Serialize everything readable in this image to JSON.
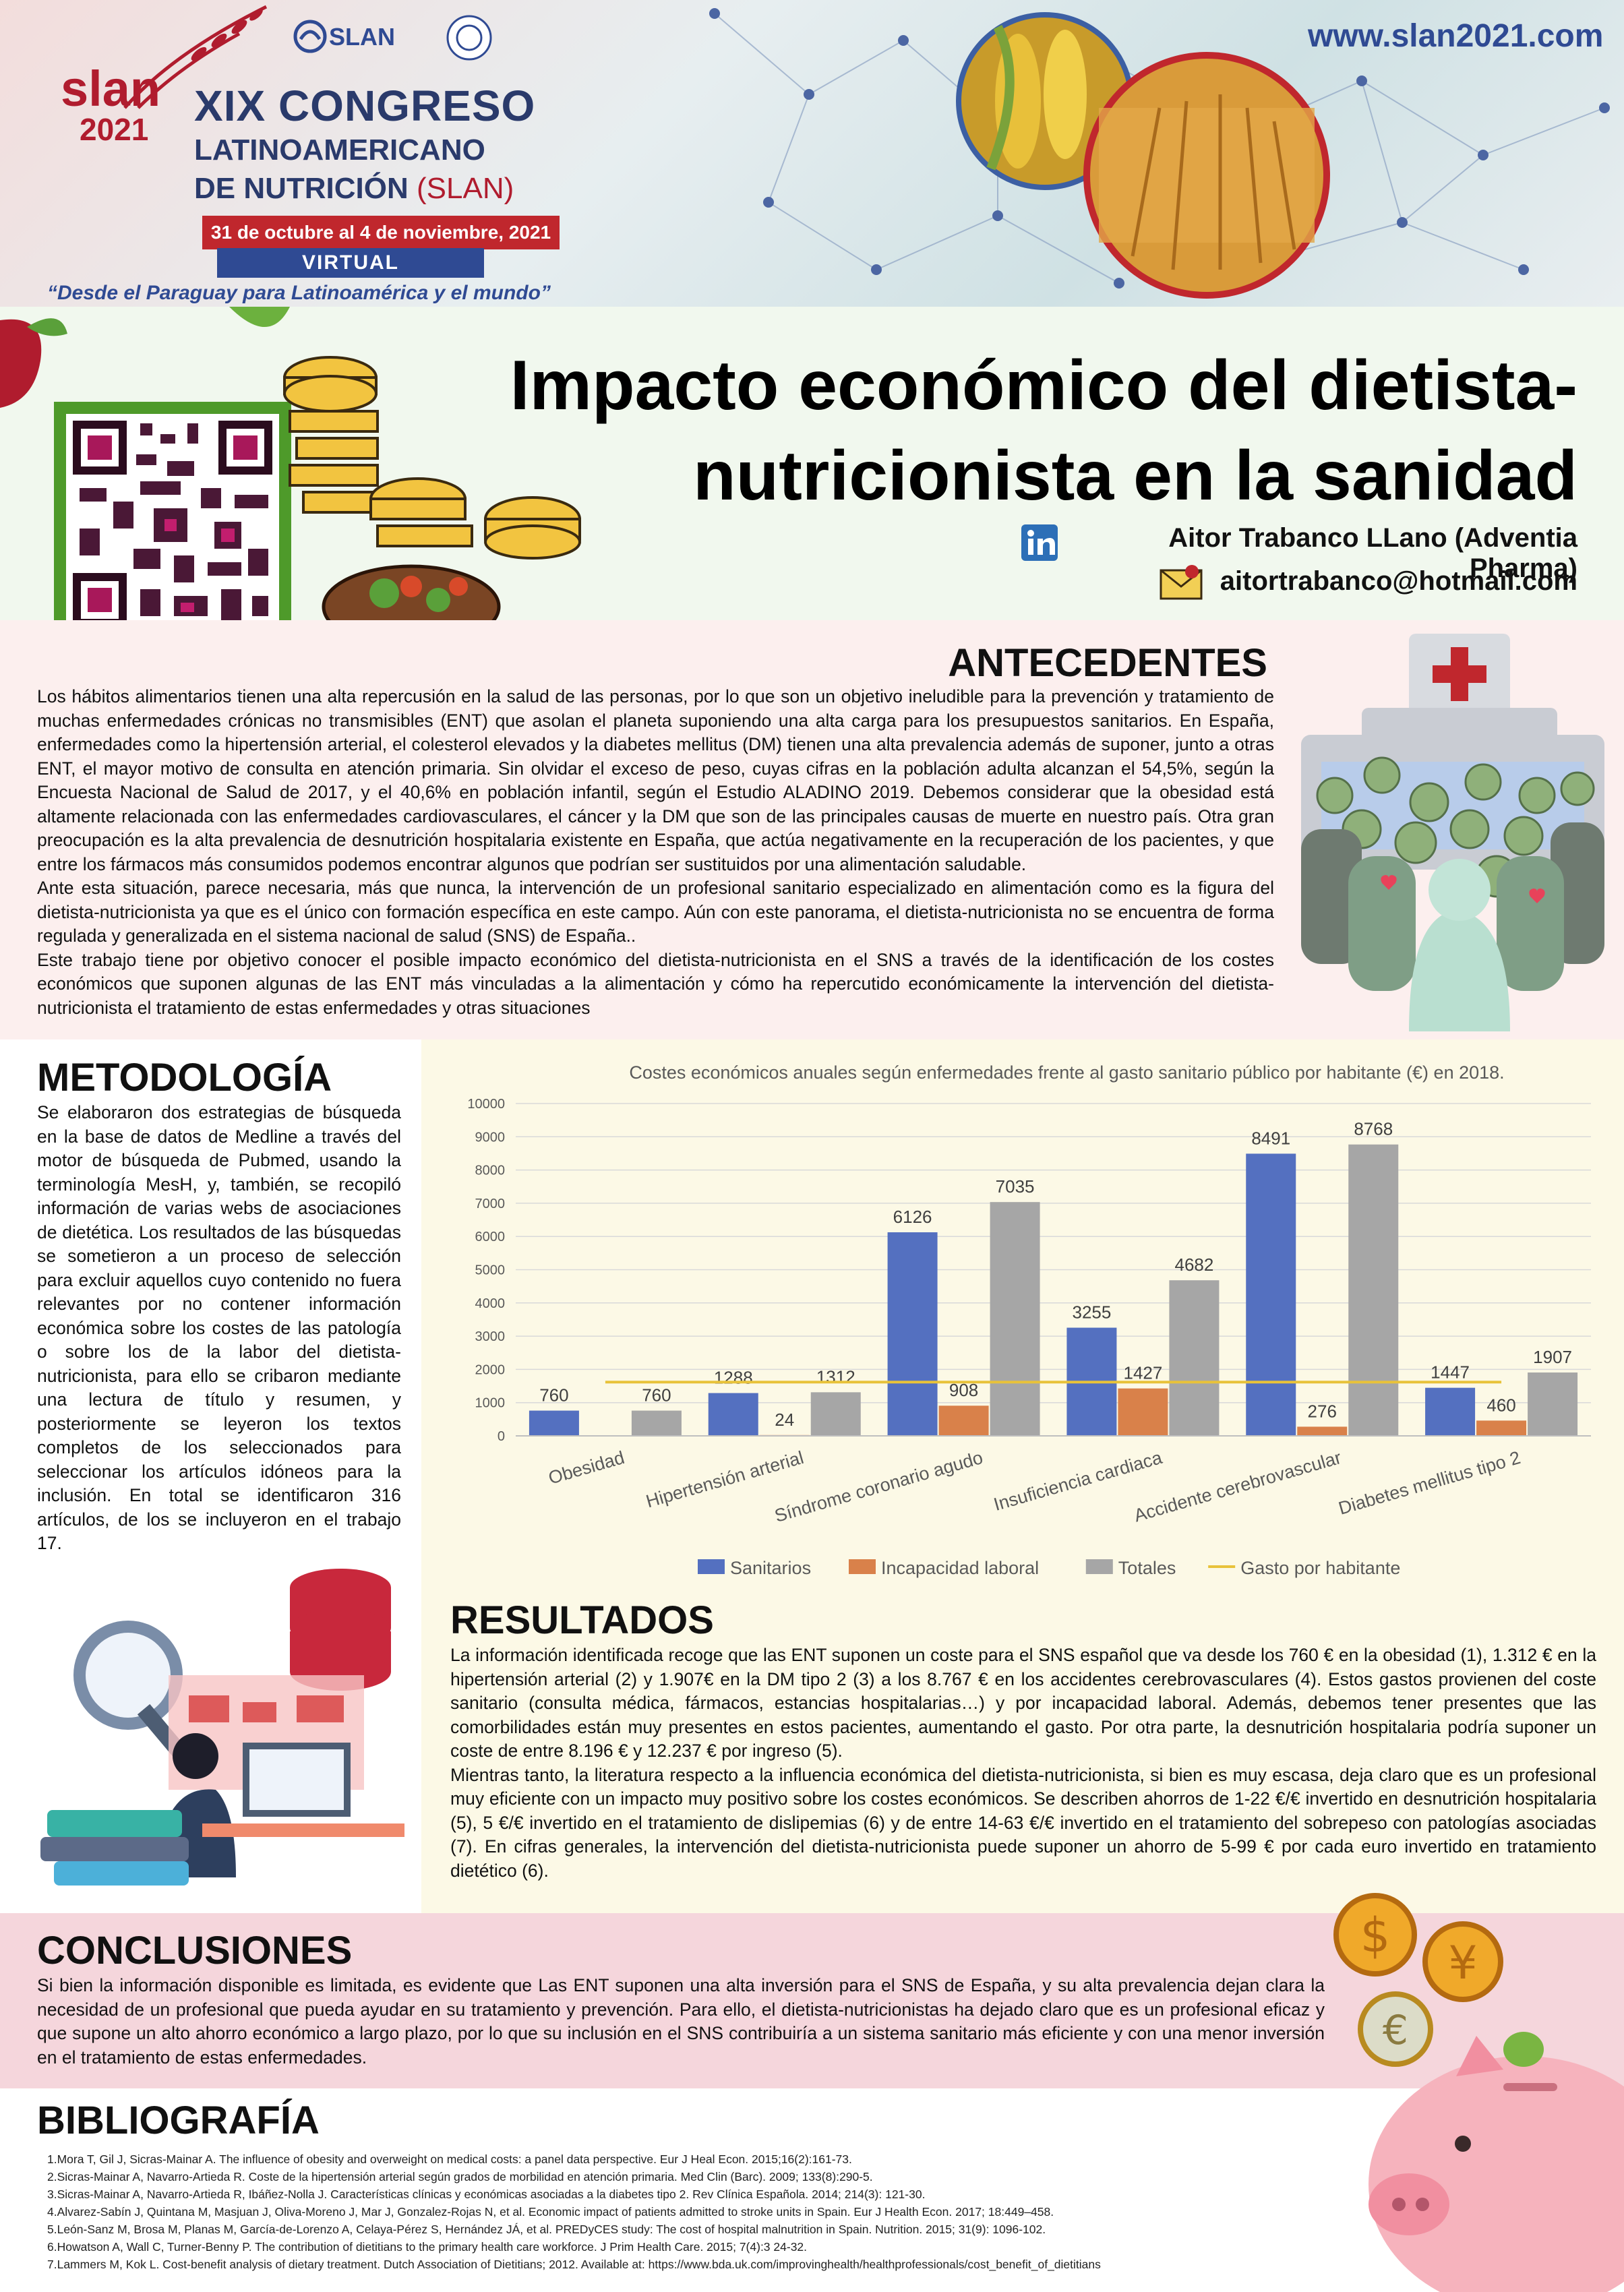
{
  "header": {
    "logo_word": "slan",
    "logo_year": "2021",
    "org": "SLAN",
    "congress_line1": "XIX CONGRESO",
    "congress_line2": "LATINOAMERICANO",
    "congress_line3": "DE NUTRICIÓN",
    "congress_line3_suffix": "(SLAN)",
    "dates": "31 de octubre al 4 de noviembre, 2021",
    "mode": "VIRTUAL",
    "motto": "“Desde el Paraguay para Latinoamérica y el mundo”",
    "website": "www.slan2021.com"
  },
  "poster": {
    "title": "Impacto económico del dietista-nutricionista en la sanidad",
    "author": "Aitor Trabanco LLano (Adventia Pharma)",
    "email": "aitortrabanco@hotmail.com"
  },
  "antecedentes": {
    "heading": "ANTECEDENTES",
    "p1": "Los hábitos alimentarios tienen una alta repercusión en la salud de las personas, por lo que son un objetivo ineludible para la prevención y tratamiento de muchas enfermedades crónicas no transmisibles (ENT) que asolan el planeta suponiendo una alta carga para los presupuestos sanitarios. En España, enfermedades como la hipertensión arterial, el colesterol elevados y la diabetes mellitus (DM) tienen una alta prevalencia además de suponer, junto a otras ENT, el mayor motivo de consulta en atención primaria. Sin olvidar el exceso de peso, cuyas cifras en la población adulta alcanzan el 54,5%, según la Encuesta Nacional de Salud de 2017, y el 40,6% en población infantil, según el Estudio ALADINO 2019. Debemos considerar que la obesidad está altamente relacionada con las enfermedades cardiovasculares, el cáncer y la DM que son de las principales causas de muerte en nuestro país. Otra gran preocupación es la alta prevalencia de desnutrición hospitalaria existente en España, que actúa negativamente en la recuperación de los pacientes, y que entre los fármacos más consumidos podemos encontrar algunos que podrían ser sustituidos por una alimentación saludable.",
    "p2": "Ante esta situación, parece necesaria, más que nunca, la intervención de un profesional sanitario especializado en alimentación como es la figura del dietista-nutricionista ya que es el único con formación específica en este campo. Aún con este panorama, el dietista-nutricionista no se encuentra de forma regulada y generalizada en el sistema nacional de salud (SNS) de España..",
    "p3": "Este trabajo tiene por objetivo conocer el posible impacto económico del dietista-nutricionista en el SNS a través de la identificación de los costes económicos que suponen algunas de las ENT más vinculadas a la alimentación y cómo ha repercutido económicamente la intervención del dietista-nutricionista el tratamiento de estas enfermedades y otras situaciones"
  },
  "metodologia": {
    "heading": "METODOLOGÍA",
    "text": "Se elaboraron dos estrategias de búsqueda en la base de datos de Medline a través del motor de búsqueda de Pubmed, usando la terminología MesH, y, también, se recopiló información de varias webs de asociaciones de dietética. Los resultados de las búsquedas se sometieron a un proceso de selección para excluir aquellos cuyo contenido no fuera relevantes por no contener información económica sobre los costes de las patología o sobre los de la labor del dietista-nutricionista, para ello se cribaron mediante una lectura de título y resumen, y posteriormente se leyeron los textos completos de los seleccionados para seleccionar los artículos idóneos para la inclusión. En total se identificaron 316 artículos, de los se incluyeron en el trabajo 17."
  },
  "chart_data": {
    "type": "bar",
    "title": "Costes económicos anuales según enfermedades frente al gasto sanitario público por habitante (€) en 2018.",
    "categories": [
      "Obesidad",
      "Hipertensión arterial",
      "Síndrome coronario agudo",
      "Insuficiencia cardiaca",
      "Accidente cerebrovascular",
      "Diabetes mellitus tipo 2"
    ],
    "series": [
      {
        "name": "Sanitarios",
        "color": "#5470c0",
        "values": [
          760,
          1288,
          6126,
          3255,
          8491,
          1447
        ]
      },
      {
        "name": "Incapacidad laboral",
        "color": "#d9814a",
        "values": [
          null,
          24,
          908,
          1427,
          276,
          460
        ]
      },
      {
        "name": "Totales",
        "color": "#a6a6a6",
        "values": [
          760,
          1312,
          7035,
          4682,
          8768,
          1907
        ]
      }
    ],
    "reference_line": {
      "name": "Gasto por habitante",
      "color": "#e8c23a",
      "value": 1617
    },
    "yticks": [
      0,
      1000,
      2000,
      3000,
      4000,
      5000,
      6000,
      7000,
      8000,
      9000,
      10000
    ],
    "ylim": [
      0,
      10000
    ],
    "grid": true,
    "legend": "bottom"
  },
  "resultados": {
    "heading": "RESULTADOS",
    "p1": "La información identificada recoge que las ENT suponen un coste para el SNS español que va desde los 760 € en la obesidad (1), 1.312 € en la hipertensión arterial (2) y 1.907€ en la DM tipo 2 (3) a los 8.767 € en los accidentes cerebrovasculares (4). Estos gastos provienen del coste sanitario (consulta médica, fármacos, estancias hospitalarias…) y por incapacidad laboral. Además, debemos tener presentes que las comorbilidades están muy presentes en estos pacientes, aumentando el gasto. Por otra parte, la desnutrición hospitalaria podría suponer un coste de entre 8.196 € y 12.237 € por ingreso (5).",
    "p2": "Mientras tanto, la literatura respecto a la influencia económica del dietista-nutricionista, si bien es muy escasa, deja claro que es un profesional muy eficiente con un impacto muy positivo sobre los costes económicos. Se describen ahorros de 1-22 €/€ invertido en desnutrición hospitalaria (5), 5 €/€ invertido en el tratamiento de dislipemias (6) y de entre 14-63 €/€ invertido en el tratamiento del sobrepeso con patologías asociadas (7). En cifras generales, la intervención del dietista-nutricionista puede suponer un ahorro de 5-99 € por cada euro invertido en tratamiento dietético (6)."
  },
  "conclusiones": {
    "heading": "CONCLUSIONES",
    "text": "Si bien la información disponible es limitada, es evidente que Las ENT suponen una alta inversión para el SNS de España, y su alta prevalencia dejan clara la necesidad de un profesional que pueda ayudar en su tratamiento y prevención. Para ello, el dietista-nutricionistas ha dejado claro que es un profesional eficaz y que supone un alto ahorro económico a largo plazo, por lo que su inclusión en el SNS contribuiría a un sistema sanitario más eficiente y con una menor inversión en el tratamiento de estas enfermedades."
  },
  "bibliografia": {
    "heading": "BIBLIOGRAFÍA",
    "items": [
      "1.Mora T, Gil J, Sicras-Mainar A. The influence of obesity and overweight on medical costs: a panel data perspective. Eur J Heal Econ. 2015;16(2):161-73.",
      "2.Sicras-Mainar A, Navarro-Artieda R. Coste de la hipertensión arterial según grados de morbilidad en atención primaria. Med Clin (Barc). 2009; 133(8):290-5.",
      "3.Sicras-Mainar A, Navarro-Artieda R, Ibáñez-Nolla J. Características clínicas y económicas asociadas a la diabetes tipo 2. Rev Clínica Española. 2014; 214(3): 121-30.",
      "4.Alvarez-Sabín J, Quintana M, Masjuan J, Oliva-Moreno J, Mar J, Gonzalez-Rojas N, et al. Economic impact of patients admitted to stroke units in Spain. Eur J Health Econ. 2017; 18:449–458.",
      "5.León-Sanz M, Brosa M, Planas M, García-de-Lorenzo A, Celaya-Pérez S, Hernández JÁ, et al. PREDyCES study: The cost of hospital malnutrition in Spain. Nutrition. 2015; 31(9): 1096-102.",
      "6.Howatson A, Wall C, Turner-Benny P. The contribution of dietitians to the primary health care workforce. J Prim Health Care. 2015; 7(4):3 24-32.",
      "7.Lammers M, Kok L. Cost-benefit analysis of dietary treatment. Dutch Association of Dietitians; 2012. Available at: https://www.bda.uk.com/improvinghealth/healthprofessionals/cost_benefit_of_dietitians"
    ]
  },
  "colors": {
    "brand_red": "#b01c2e",
    "brand_blue": "#2f4a93",
    "qr_frame_green": "#4e9a2a"
  }
}
